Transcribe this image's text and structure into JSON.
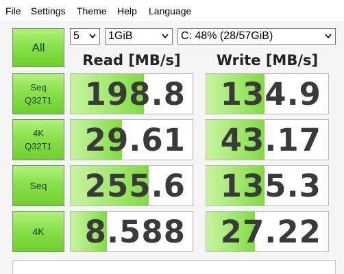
{
  "menu": {
    "file": "File",
    "settings": "Settings",
    "theme": "Theme",
    "help": "Help",
    "language": "Language"
  },
  "controls": {
    "all_label": "All",
    "count": "5",
    "size": "1GiB",
    "drive": "C: 48% (28/57GiB)"
  },
  "headers": {
    "read": "Read [MB/s]",
    "write": "Write [MB/s]"
  },
  "tests": [
    {
      "line1": "Seq",
      "line2": "Q32T1",
      "read": "198.8",
      "write": "134.9",
      "read_fill": 0.6,
      "write_fill": 0.48
    },
    {
      "line1": "4K",
      "line2": "Q32T1",
      "read": "29.61",
      "write": "43.17",
      "read_fill": 0.42,
      "write_fill": 0.48
    },
    {
      "line1": "Seq",
      "line2": "",
      "read": "255.6",
      "write": "135.3",
      "read_fill": 0.64,
      "write_fill": 0.48
    },
    {
      "line1": "4K",
      "line2": "",
      "read": "8.588",
      "write": "27.22",
      "read_fill": 0.3,
      "write_fill": 0.4
    }
  ],
  "colors": {
    "button_green": "#8ae04d",
    "bar_green": "#9ee86a",
    "value_text": "#3a3a3a"
  }
}
